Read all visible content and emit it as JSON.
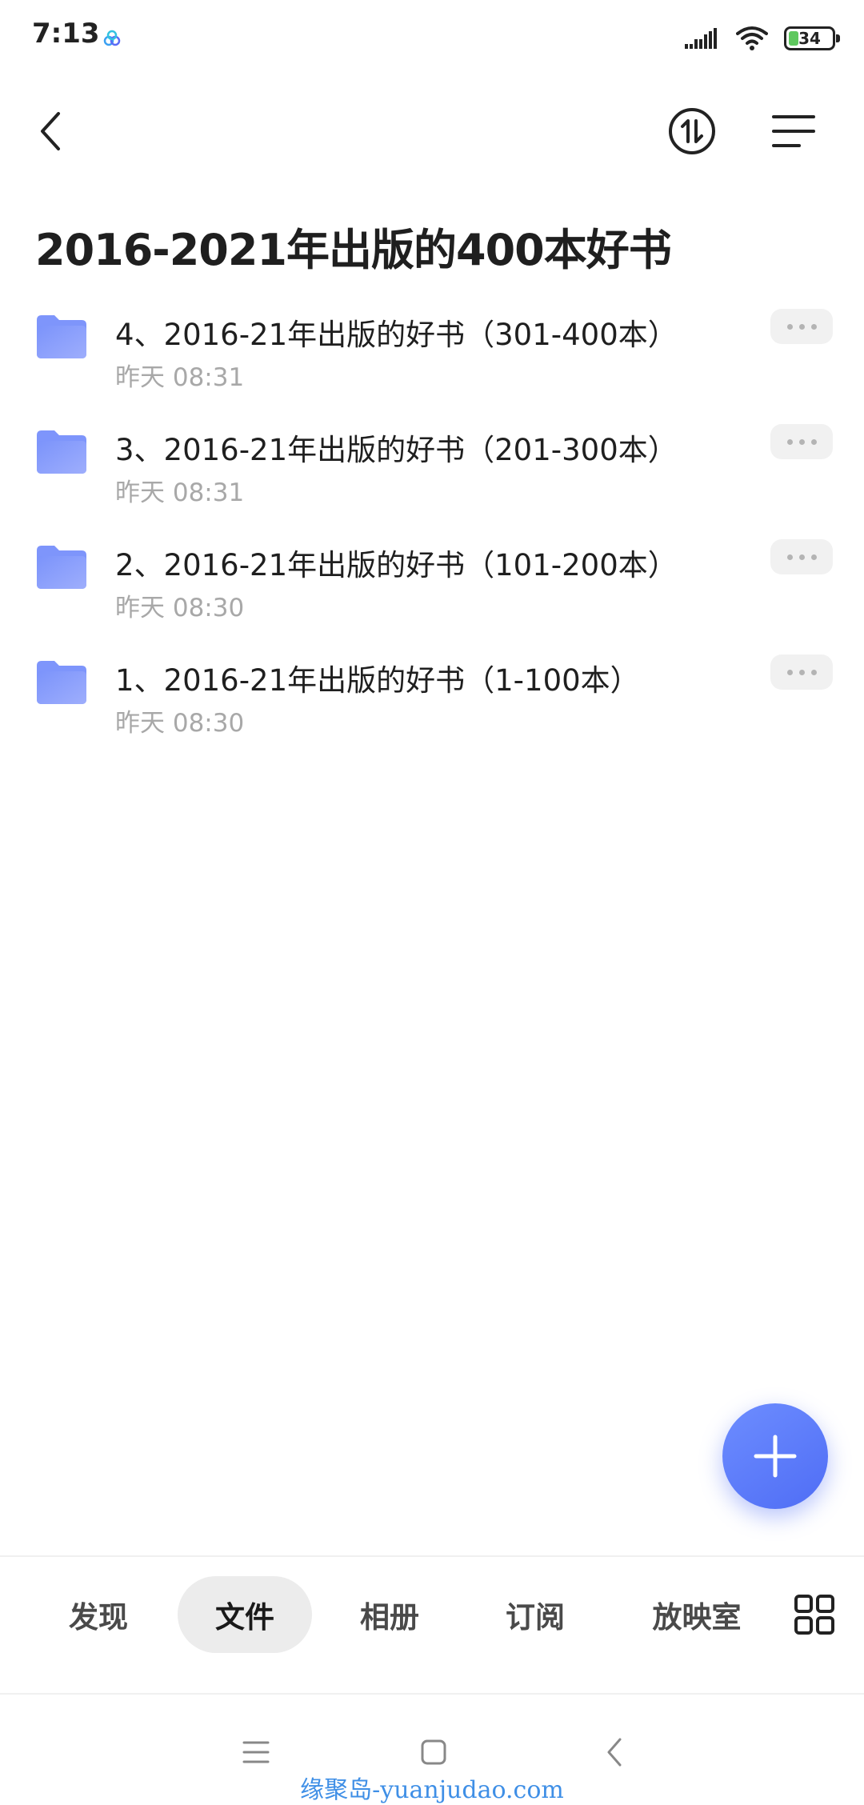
{
  "status_bar": {
    "time": "7:13",
    "battery_level": "34",
    "icons": [
      "cloud-app-icon",
      "signal-icon",
      "wifi-icon",
      "battery-icon"
    ]
  },
  "header": {
    "back_icon": "chevron-left-icon",
    "sort_icon": "sort-icon",
    "menu_icon": "menu-icon"
  },
  "page": {
    "title": "2016-2021年出版的400本好书"
  },
  "files": [
    {
      "name": "4、2016-21年出版的好书（301-400本）",
      "time": "昨天 08:31",
      "icon": "folder-icon"
    },
    {
      "name": "3、2016-21年出版的好书（201-300本）",
      "time": "昨天 08:31",
      "icon": "folder-icon"
    },
    {
      "name": "2、2016-21年出版的好书（101-200本）",
      "time": "昨天 08:30",
      "icon": "folder-icon"
    },
    {
      "name": "1、2016-21年出版的好书（1-100本）",
      "time": "昨天 08:30",
      "icon": "folder-icon"
    }
  ],
  "fab": {
    "icon": "plus-icon"
  },
  "tabs": [
    {
      "label": "发现",
      "active": false
    },
    {
      "label": "文件",
      "active": true
    },
    {
      "label": "相册",
      "active": false
    },
    {
      "label": "订阅",
      "active": false
    },
    {
      "label": "放映室",
      "active": false
    }
  ],
  "tab_grid_icon": "grid-icon",
  "nav_bar": {
    "icons": [
      "recent-apps-icon",
      "home-icon",
      "back-icon"
    ]
  },
  "watermark": "缘聚岛-yuanjudao.com",
  "colors": {
    "accent": "#5673f7",
    "folder": "#8da0fb",
    "secondary_text": "#a8a8a8",
    "battery": "#5ec85e",
    "watermark": "#3f8fe6"
  }
}
